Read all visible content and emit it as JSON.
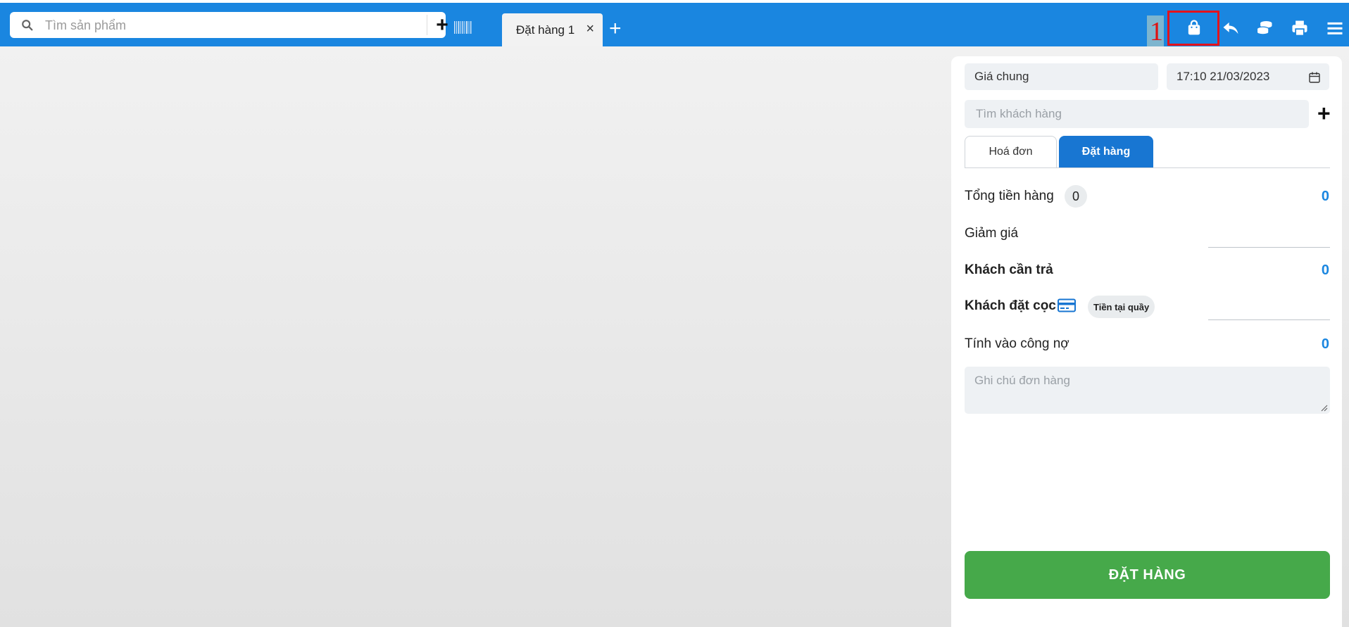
{
  "topbar": {
    "search": {
      "placeholder": "Tìm sản phẩm",
      "add_label": "+"
    },
    "tabs": [
      {
        "label": "Đặt hàng 1",
        "close_label": "×"
      }
    ],
    "tab_add_label": "+",
    "annotation_number": "1",
    "icons": [
      "shopping-bag-icon",
      "undo-icon",
      "coins-icon",
      "printer-icon",
      "menu-icon"
    ],
    "colors": {
      "background": "#1a86e0",
      "annotation": "#e4121b"
    }
  },
  "order_panel": {
    "price_list": "Giá chung",
    "datetime": "17:10 21/03/2023",
    "customer_search_placeholder": "Tìm khách hàng",
    "customer_add_label": "+",
    "tabs": [
      {
        "label": "Hoá đơn",
        "active": false
      },
      {
        "label": "Đặt hàng",
        "active": true
      }
    ],
    "total_label": "Tổng tiền hàng",
    "total_count": "0",
    "total_value": "0",
    "discount_label": "Giảm giá",
    "customer_pay_label": "Khách cần trả",
    "customer_pay_value": "0",
    "deposit_label": "Khách đặt cọc",
    "deposit_method": "Tiền tại quầy",
    "debt_label": "Tính vào công nợ",
    "debt_value": "0",
    "note_placeholder": "Ghi chú đơn hàng",
    "order_button": "ĐẶT HÀNG",
    "colors": {
      "accent": "#1876d2",
      "order_button": "#46a94a",
      "value": "#1a86e0"
    }
  }
}
